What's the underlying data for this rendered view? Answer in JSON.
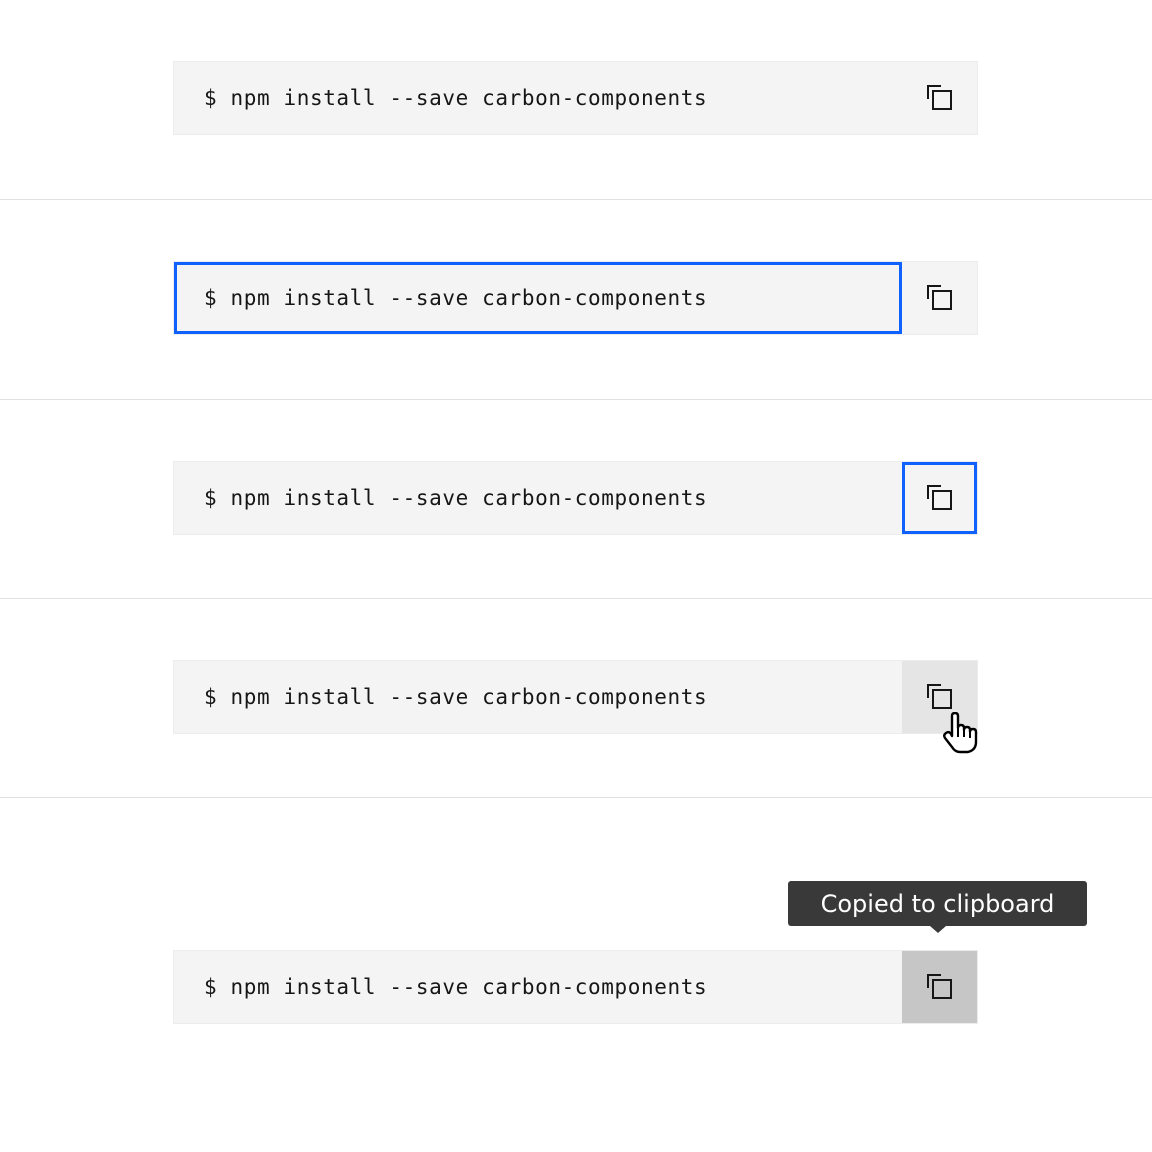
{
  "snippets": [
    {
      "state": "default",
      "code": "$ npm install --save carbon-components",
      "copy_icon": "copy-icon"
    },
    {
      "state": "code-focused",
      "code": "$ npm install --save carbon-components",
      "copy_icon": "copy-icon"
    },
    {
      "state": "button-focused",
      "code": "$ npm install --save carbon-components",
      "copy_icon": "copy-icon"
    },
    {
      "state": "button-hover",
      "code": "$ npm install --save carbon-components",
      "copy_icon": "copy-icon",
      "cursor_icon": "hand-pointer-icon"
    },
    {
      "state": "button-active",
      "code": "$ npm install --save carbon-components",
      "copy_icon": "copy-icon"
    }
  ],
  "tooltip": {
    "text": "Copied to clipboard"
  },
  "colors": {
    "focus": "#0f62fe",
    "snippet_bg": "#f4f4f4",
    "hover_bg": "#e5e5e5",
    "active_bg": "#c6c6c6",
    "tooltip_bg": "#393939",
    "divider": "#e0e0e0"
  }
}
